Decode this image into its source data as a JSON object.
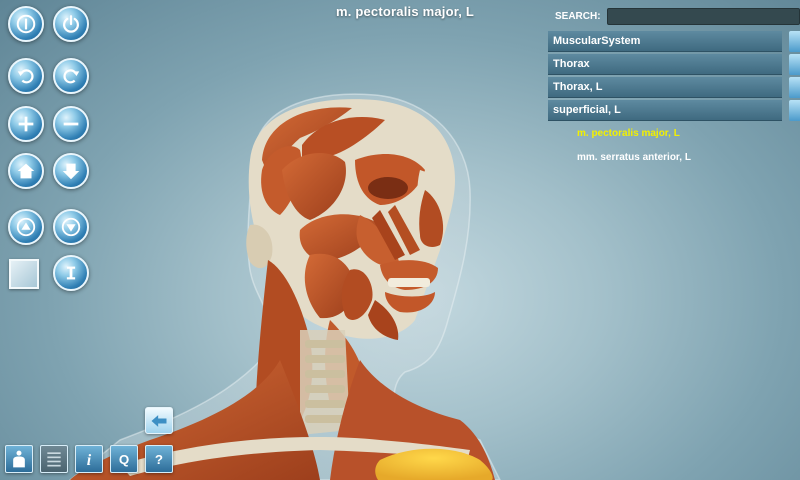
{
  "viewer": {
    "selected_structure": "m. pectoralis major, L",
    "highlight_color": "#f3c233",
    "muscle_color": "#c15a2b",
    "bone_color": "#e4dcc8"
  },
  "search": {
    "label": "SEARCH:",
    "value": ""
  },
  "breadcrumbs": [
    "MuscularSystem",
    "Thorax",
    "Thorax, L",
    "superficial, L"
  ],
  "tree": {
    "items": [
      {
        "label": "m. pectoralis major, L",
        "selected": true
      },
      {
        "label": "mm. serratus anterior, L",
        "selected": false
      }
    ]
  },
  "toolbar_left": {
    "buttons": [
      "info-icon",
      "power-icon",
      "rotate-left-icon",
      "rotate-right-icon",
      "zoom-in-icon",
      "zoom-out-icon",
      "home-icon",
      "down-arrow-icon",
      "move-up-icon",
      "move-down-icon",
      "swatch-icon",
      "cursor-icon"
    ]
  },
  "toolbar_bottom": {
    "buttons": [
      "body-icon",
      "list-icon",
      "info-icon",
      "quiz-icon",
      "help-icon"
    ],
    "info_glyph": "i",
    "quiz_glyph": "Q",
    "help_glyph": "?"
  },
  "accent_color": "#2f7fb4"
}
